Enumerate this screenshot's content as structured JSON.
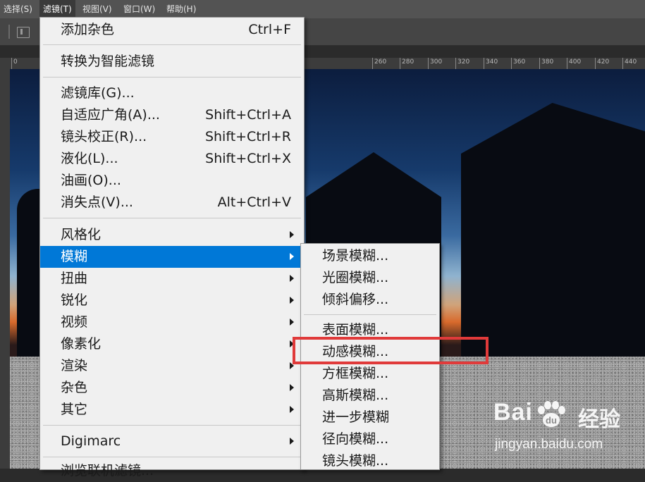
{
  "menubar": {
    "items": [
      "选择(S)",
      "滤镜(T)",
      "视图(V)",
      "窗口(W)",
      "帮助(H)"
    ],
    "active_index": 1
  },
  "ruler": {
    "ticks": [
      "0",
      "260",
      "280",
      "300",
      "320",
      "340",
      "360",
      "380",
      "400",
      "420",
      "440"
    ]
  },
  "filter_menu": {
    "items": [
      {
        "label": "添加杂色",
        "shortcut": "Ctrl+F"
      },
      {
        "label": "转换为智能滤镜",
        "shortcut": ""
      },
      {
        "label": "滤镜库(G)...",
        "shortcut": ""
      },
      {
        "label": "自适应广角(A)...",
        "shortcut": "Shift+Ctrl+A"
      },
      {
        "label": "镜头校正(R)...",
        "shortcut": "Shift+Ctrl+R"
      },
      {
        "label": "液化(L)...",
        "shortcut": "Shift+Ctrl+X"
      },
      {
        "label": "油画(O)...",
        "shortcut": ""
      },
      {
        "label": "消失点(V)...",
        "shortcut": "Alt+Ctrl+V"
      },
      {
        "label": "风格化",
        "shortcut": ""
      },
      {
        "label": "模糊",
        "shortcut": ""
      },
      {
        "label": "扭曲",
        "shortcut": ""
      },
      {
        "label": "锐化",
        "shortcut": ""
      },
      {
        "label": "视频",
        "shortcut": ""
      },
      {
        "label": "像素化",
        "shortcut": ""
      },
      {
        "label": "渲染",
        "shortcut": ""
      },
      {
        "label": "杂色",
        "shortcut": ""
      },
      {
        "label": "其它",
        "shortcut": ""
      },
      {
        "label": "Digimarc",
        "shortcut": ""
      },
      {
        "label": "浏览联机滤镜...",
        "shortcut": ""
      }
    ],
    "highlighted_index": 9
  },
  "blur_submenu": {
    "items": [
      "场景模糊...",
      "光圈模糊...",
      "倾斜偏移...",
      "表面模糊...",
      "动感模糊...",
      "方框模糊...",
      "高斯模糊...",
      "进一步模糊",
      "径向模糊...",
      "镜头模糊..."
    ],
    "annotated_index": 4
  },
  "watermark": {
    "logo_text": "Bai",
    "logo_suffix": "du",
    "brand_text": "经验",
    "url": "jingyan.baidu.com"
  },
  "colors": {
    "highlight": "#0078d7",
    "annotation": "#e03a3a",
    "menu_bg": "#f0f0f0"
  },
  "icons": {
    "submenu_arrow": "chevron-right-icon"
  }
}
